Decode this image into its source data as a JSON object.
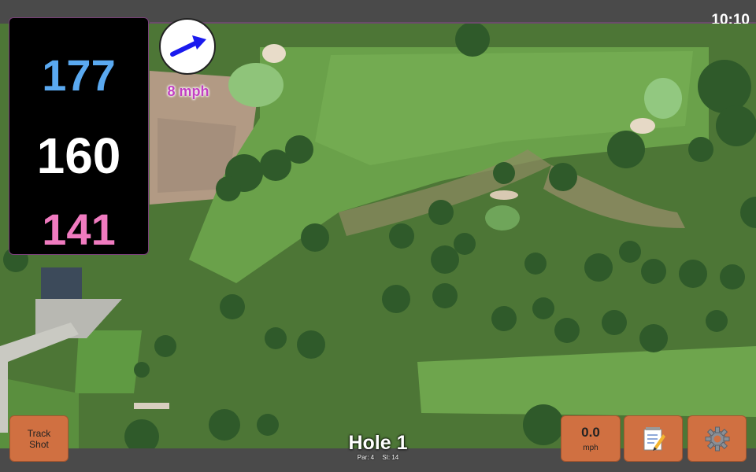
{
  "status": {
    "time": "10:10"
  },
  "distances": {
    "back": "177",
    "middle": "160",
    "front": "141"
  },
  "wind": {
    "speed_label": "8 mph"
  },
  "buttons": {
    "track_shot_line1": "Track",
    "track_shot_line2": "Shot",
    "speed_value": "0.0",
    "speed_unit": "mph",
    "notes_icon": "notepad-icon",
    "settings_icon": "gear-icon"
  },
  "hole": {
    "title": "Hole 1",
    "par": "Par: 4",
    "si": "SI: 14"
  },
  "colors": {
    "back_distance": "#5aa9f0",
    "middle_distance": "#ffffff",
    "front_distance": "#f07bc0",
    "button_bg": "#d07041",
    "wind_arrow": "#1a1aee"
  }
}
